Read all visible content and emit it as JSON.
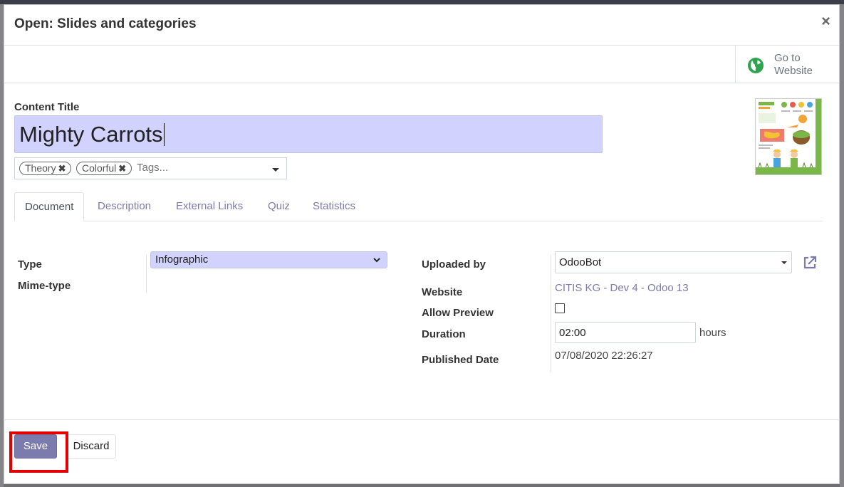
{
  "dialog": {
    "title": "Open: Slides and categories",
    "close_symbol": "×"
  },
  "button_box": {
    "goto_line1": "Go to",
    "goto_line2": "Website",
    "goto_icon": "globe-icon",
    "goto_icon_color": "#2ea44f"
  },
  "form": {
    "content_title_label": "Content Title",
    "content_title_value": "Mighty Carrots",
    "title_input_bg": "#d2d2ff",
    "tags": [
      {
        "label": "Theory"
      },
      {
        "label": "Colorful"
      }
    ],
    "tags_placeholder": "Tags...",
    "thumbnail_icon": "infographic-thumbnail"
  },
  "tabs": [
    {
      "label": "Document",
      "active": true
    },
    {
      "label": "Description",
      "active": false
    },
    {
      "label": "External Links",
      "active": false
    },
    {
      "label": "Quiz",
      "active": false
    },
    {
      "label": "Statistics",
      "active": false
    }
  ],
  "document": {
    "type_label": "Type",
    "type_value": "Infographic",
    "mime_label": "Mime-type",
    "uploaded_by_label": "Uploaded by",
    "uploaded_by_value": "OdooBot",
    "website_label": "Website",
    "website_value": "CITIS KG - Dev 4 - Odoo 13",
    "allow_preview_label": "Allow Preview",
    "allow_preview_checked": false,
    "duration_label": "Duration",
    "duration_value": "02:00",
    "duration_unit": "hours",
    "published_label": "Published Date",
    "published_value": "07/08/2020 22:26:27"
  },
  "footer": {
    "save_label": "Save",
    "discard_label": "Discard",
    "accent_color": "#7c7bad",
    "highlight_color": "#e30000"
  }
}
